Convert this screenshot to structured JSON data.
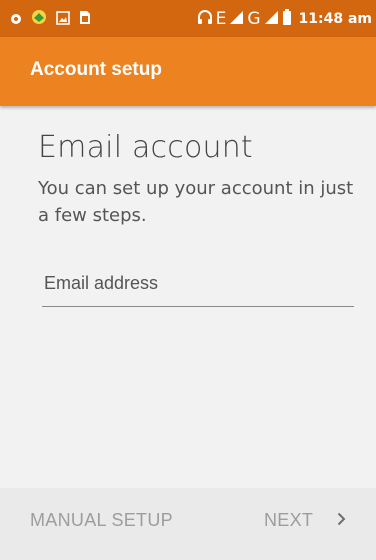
{
  "status_bar": {
    "icons_left": [
      "notification-dot-icon",
      "app-notification-icon",
      "image-icon",
      "sim-card-icon"
    ],
    "icons_right": [
      "headset-icon",
      "signal-icon",
      "signal-icon",
      "battery-icon"
    ],
    "network_1": "E",
    "network_2": "G",
    "time": "11:48 am"
  },
  "app_bar": {
    "title": "Account setup",
    "background": "#ec8220"
  },
  "main": {
    "heading": "Email account",
    "subtitle": "You can set up your account in just a few steps.",
    "email_field": {
      "placeholder": "Email address",
      "value": ""
    }
  },
  "bottom_bar": {
    "manual_setup_label": "MANUAL SETUP",
    "next_label": "NEXT",
    "next_icon": "chevron-right-icon"
  }
}
